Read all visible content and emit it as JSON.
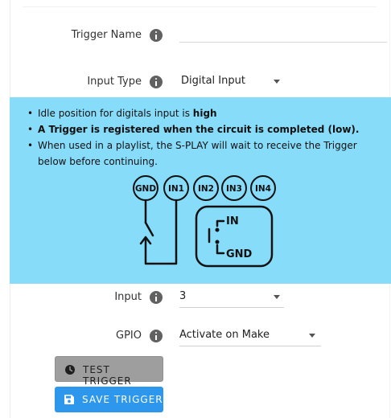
{
  "form": {
    "trigger_name": {
      "label": "Trigger Name",
      "value": "",
      "icon": "info-icon"
    },
    "input_type": {
      "label": "Input Type",
      "value": "Digital Input",
      "icon": "info-icon"
    },
    "input": {
      "label": "Input",
      "value": "3",
      "icon": "info-icon"
    },
    "gpio": {
      "label": "GPIO",
      "value": "Activate on Make",
      "icon": "info-icon"
    }
  },
  "info_panel": {
    "bg_color": "#87dcfa",
    "bullet1_prefix": "Idle position for digitals input is ",
    "bullet1_bold": "high",
    "bullet2": "A Trigger is registered when the circuit is completed (low).",
    "bullet3": "When used in a playlist, the S-PLAY will wait to receive the Trigger below before continuing."
  },
  "diagram": {
    "terminals": [
      "GND",
      "IN1",
      "IN2",
      "IN3",
      "IN4"
    ],
    "switch_labels": {
      "in": "IN",
      "gnd": "GND"
    }
  },
  "buttons": {
    "test": {
      "label": "TEST TRIGGER",
      "icon": "clock-icon",
      "color": "#9e9e9e"
    },
    "save": {
      "label": "SAVE TRIGGER",
      "icon": "save-icon",
      "color": "#2d97ee"
    }
  }
}
